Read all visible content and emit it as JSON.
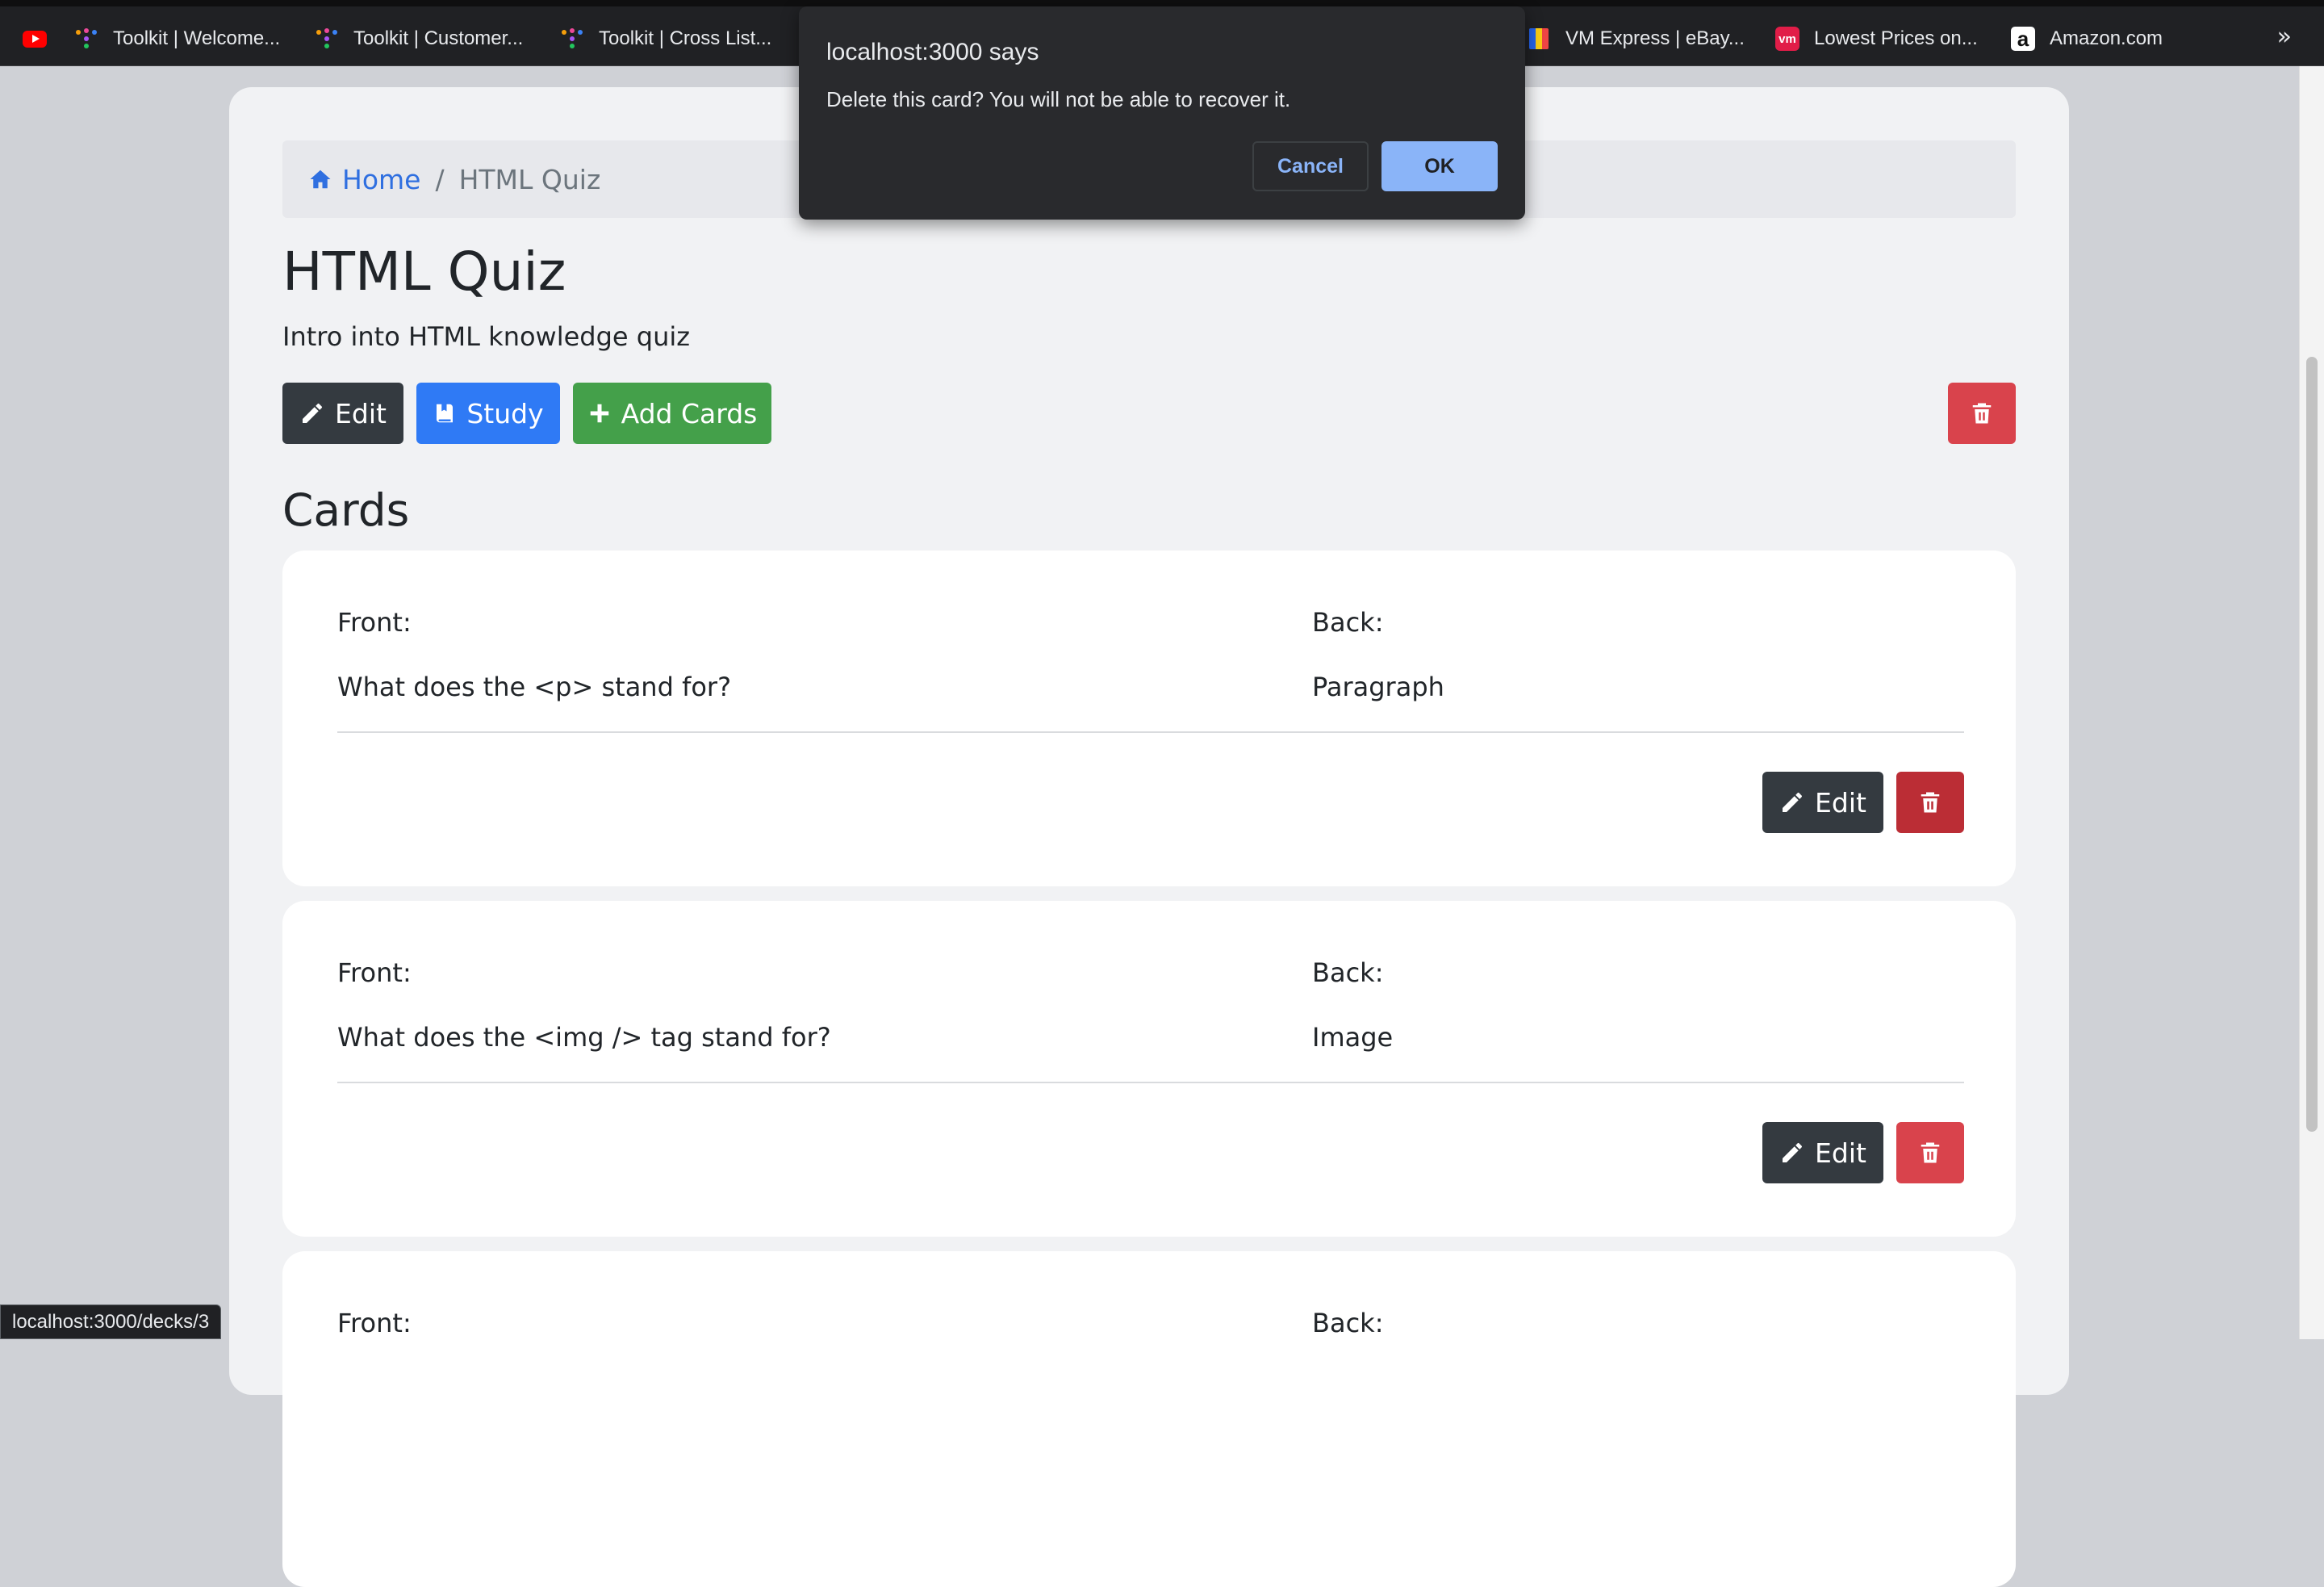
{
  "bookmarks": [
    {
      "label": "",
      "icon": "youtube-icon"
    },
    {
      "label": "Toolkit | Welcome...",
      "icon": "toolkit-icon"
    },
    {
      "label": "Toolkit | Customer...",
      "icon": "toolkit-icon"
    },
    {
      "label": "Toolkit | Cross List...",
      "icon": "toolkit-icon"
    },
    {
      "label": "VM Express | eBay...",
      "icon": "vm-express-icon"
    },
    {
      "label": "Lowest Prices on...",
      "icon": "vm-icon"
    },
    {
      "label": "Amazon.com",
      "icon": "amazon-icon"
    }
  ],
  "bookmarks_more": "»",
  "breadcrumb": {
    "home": "Home",
    "separator": "/",
    "current": "HTML Quiz"
  },
  "deck": {
    "title": "HTML Quiz",
    "description": "Intro into HTML knowledge quiz"
  },
  "actions": {
    "edit": "Edit",
    "study": "Study",
    "add_cards": "Add Cards"
  },
  "cards_heading": "Cards",
  "cards": [
    {
      "front_label": "Front:",
      "back_label": "Back:",
      "front": "What does the <p> stand for?",
      "back": "Paragraph",
      "edit": "Edit"
    },
    {
      "front_label": "Front:",
      "back_label": "Back:",
      "front": "What does the <img /> tag stand for?",
      "back": "Image",
      "edit": "Edit"
    },
    {
      "front_label": "Front:",
      "back_label": "Back:"
    }
  ],
  "dialog": {
    "title": "localhost:3000 says",
    "message": "Delete this card? You will not be able to recover it.",
    "cancel": "Cancel",
    "ok": "OK"
  },
  "status_url": "localhost:3000/decks/3",
  "colors": {
    "primary": "#2f7af5",
    "success": "#44a04a",
    "danger": "#d9434c",
    "dark": "#343a40",
    "link": "#2f6fe0",
    "dialog_bg": "#292a2d",
    "dialog_accent": "#8ab4f8"
  }
}
